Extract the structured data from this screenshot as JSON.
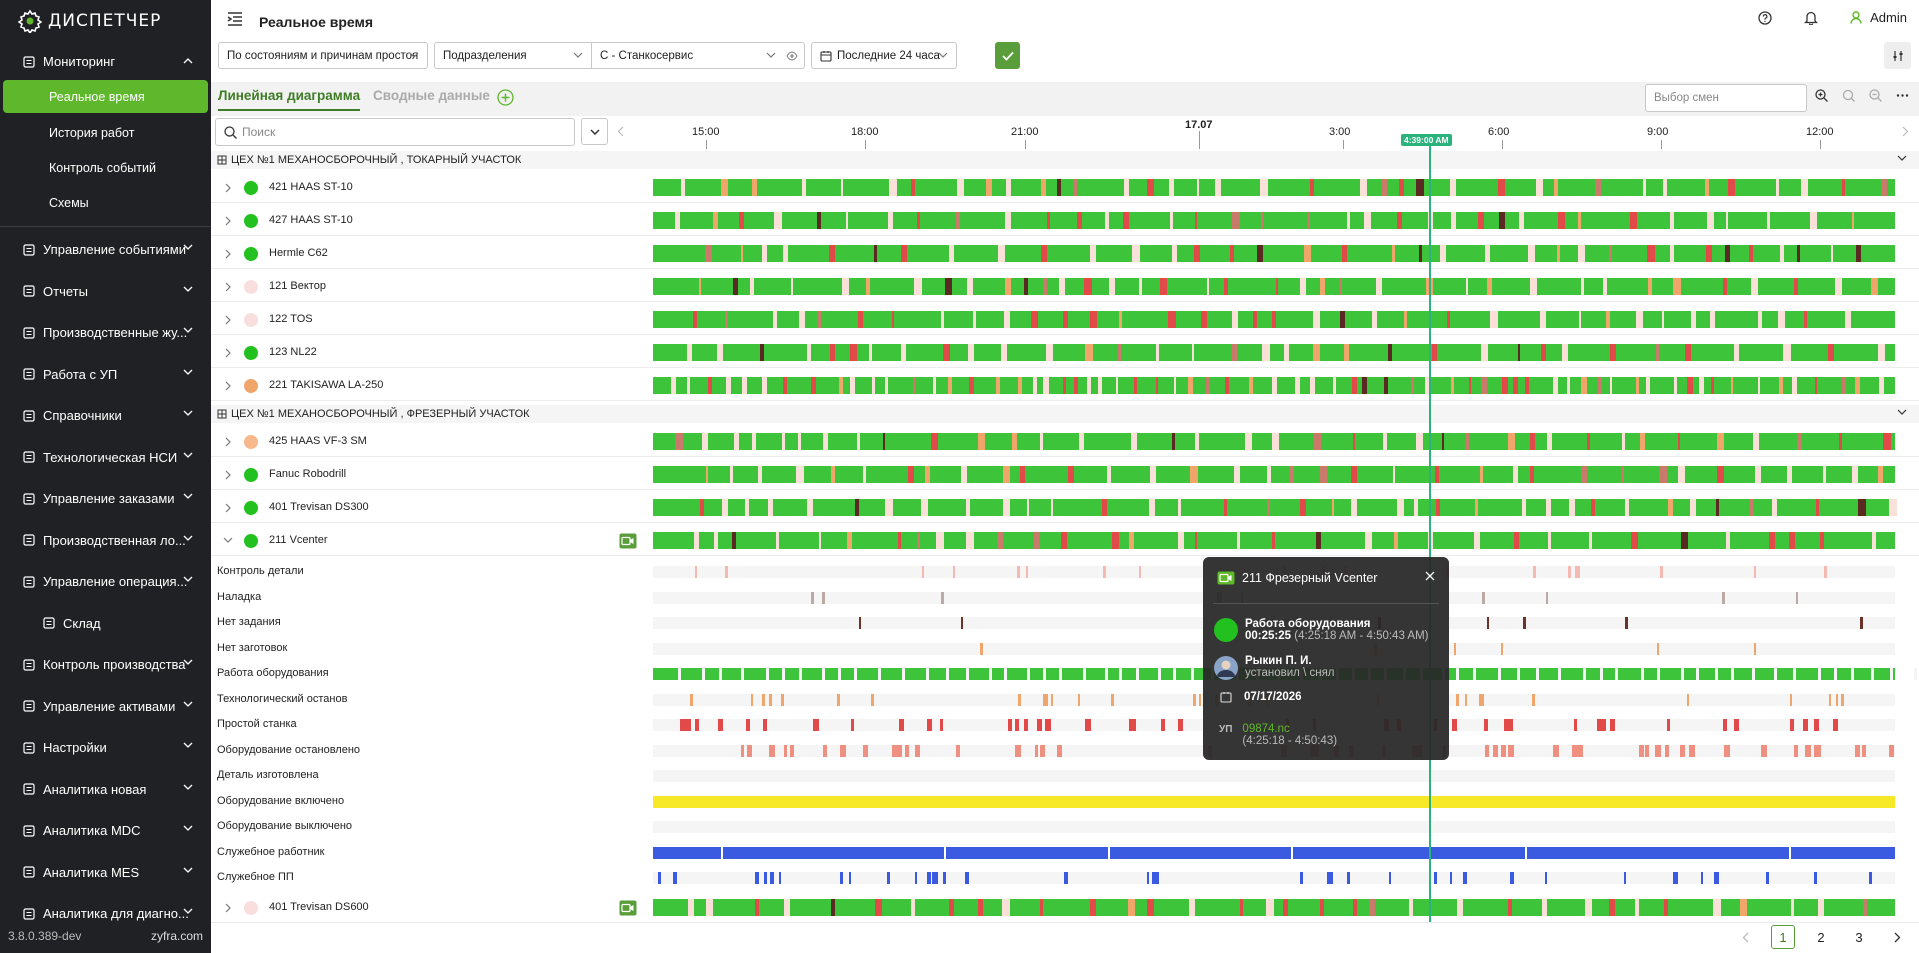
{
  "app": {
    "name": "ДИСПЕТЧЕР",
    "version": "3.8.0.389-dev",
    "vendor": "zyfra.com"
  },
  "sidebar": {
    "monitoring": {
      "label": "Мониторинг",
      "sub": [
        "Реальное время",
        "История работ",
        "Контроль событий",
        "Схемы"
      ]
    },
    "items": [
      {
        "label": "Управление событиями",
        "icon": "bell"
      },
      {
        "label": "Отчеты",
        "icon": "chart"
      },
      {
        "label": "Производственные жу...",
        "icon": "journal"
      },
      {
        "label": "Работа с УП",
        "icon": "file"
      },
      {
        "label": "Справочники",
        "icon": "book"
      },
      {
        "label": "Технологическая НСИ",
        "icon": "list"
      },
      {
        "label": "Управление заказами",
        "icon": "grid"
      },
      {
        "label": "Производственная ло...",
        "icon": "doc"
      },
      {
        "label": "Управление операция...",
        "icon": "grid"
      }
    ],
    "child": {
      "label": "Склад",
      "icon": "box"
    },
    "items2": [
      {
        "label": "Контроль производства",
        "icon": "gear"
      },
      {
        "label": "Управление активами",
        "icon": "wrench"
      },
      {
        "label": "Настройки",
        "icon": "settings"
      },
      {
        "label": "Аналитика новая",
        "icon": "list"
      },
      {
        "label": "Аналитика MDC",
        "icon": "list"
      },
      {
        "label": "Аналитика MES",
        "icon": "list"
      },
      {
        "label": "Аналитика для диагно...",
        "icon": "list"
      }
    ]
  },
  "header": {
    "title": "Реальное время",
    "user": "Admin"
  },
  "filters": {
    "states": "По состояниям и причинам простоя",
    "divisions": "Подразделения",
    "company": "С - Станкосервис",
    "period": "Последние 24 часа"
  },
  "tabs": {
    "linear": "Линейная диаграмма",
    "summary": "Сводные данные"
  },
  "shifts_placeholder": "Выбор смен",
  "search_placeholder": "Поиск",
  "timeline": {
    "labels": [
      "15:00",
      "18:00",
      "21:00",
      "17.07",
      "3:00",
      "6:00",
      "9:00",
      "12:00"
    ],
    "now": "4:39:00 AM"
  },
  "sections": [
    {
      "title": "ЦЕХ №1 МЕХАНОСБОРОЧНЫЙ , ТОКАРНЫЙ УЧАСТОК"
    },
    {
      "title": "ЦЕХ №1 МЕХАНОСБОРОЧНЫЙ , ФРЕЗЕРНЫЙ УЧАСТОК"
    }
  ],
  "machines": [
    {
      "name": "421 HAAS ST-10",
      "status": "#22c11f"
    },
    {
      "name": "427 HAAS ST-10",
      "status": "#22c11f"
    },
    {
      "name": "Hermle C62",
      "status": "#22c11f"
    },
    {
      "name": "121 Вектор",
      "status": "#f9dede"
    },
    {
      "name": "122 TOS",
      "status": "#f9dede"
    },
    {
      "name": "123 NL22",
      "status": "#22c11f"
    },
    {
      "name": "221 TAKISAWA LA-250",
      "status": "#f0a56b"
    },
    {
      "name": "425 HAAS VF-3 SM",
      "status": "#f7b98c"
    },
    {
      "name": "Fanuc Robodrill",
      "status": "#22c11f"
    },
    {
      "name": "401 Trevisan DS300",
      "status": "#22c11f"
    },
    {
      "name": "211 Vcenter",
      "status": "#22c11f"
    },
    {
      "name": "401 Trevisan DS600",
      "status": "#f9dede"
    }
  ],
  "subrows": [
    "Контроль детали",
    "Наладка",
    "Нет задания",
    "Нет заготовок",
    "Работа оборудования",
    "Технологический останов",
    "Простой станка",
    "Оборудование остановлено",
    "Деталь изготовлена",
    "Оборудование включено",
    "Оборудование выключено",
    "Служебное работник",
    "Служебное ПП"
  ],
  "popup": {
    "title": "211 Фрезерный Vcenter",
    "state": "Работа оборудования",
    "duration": "00:25:25",
    "range": "(4:25:18 AM - 4:50:43 AM)",
    "person": "Рыкин П. И.",
    "action": "установил \\ снял",
    "date": "07/17/2026",
    "up_label": "УП",
    "up_file": "09874.nc",
    "up_range": "(4:25:18 - 4:50:43)"
  },
  "pager": {
    "pages": [
      "1",
      "2",
      "3"
    ]
  },
  "colors": {
    "accent": "#5fb72b",
    "work": "#3ec43a",
    "idle": "#e24a4a",
    "setup": "#f0a56b",
    "off": "#5a2a22",
    "yellow": "#f7e928",
    "blue": "#3a5be0"
  }
}
